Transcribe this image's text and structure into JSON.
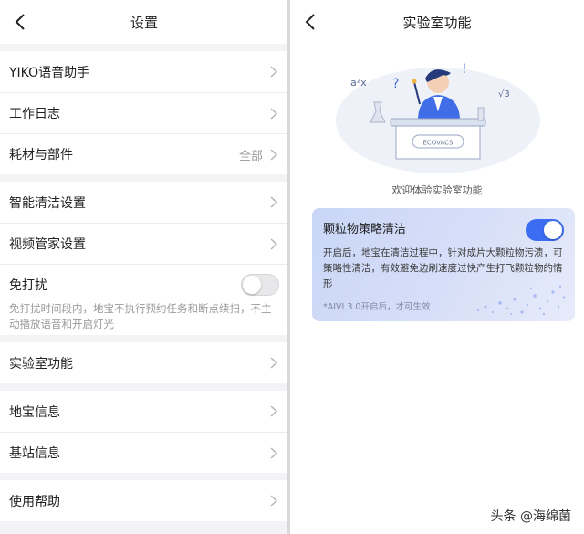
{
  "settings": {
    "title": "设置",
    "groups": [
      {
        "items": [
          {
            "label": "YIKO语音助手"
          },
          {
            "label": "工作日志"
          },
          {
            "label": "耗材与部件",
            "value": "全部"
          }
        ]
      },
      {
        "items": [
          {
            "label": "智能清洁设置"
          },
          {
            "label": "视频管家设置"
          }
        ]
      },
      {
        "items": [
          {
            "label": "实验室功能"
          }
        ]
      },
      {
        "items": [
          {
            "label": "地宝信息"
          },
          {
            "label": "基站信息"
          }
        ]
      },
      {
        "items": [
          {
            "label": "使用帮助"
          }
        ]
      }
    ],
    "dnd": {
      "label": "免打扰",
      "desc": "免打扰时间段内，地宝不执行预约任务和断点续扫，不主动播放语音和开启灯光",
      "enabled": false
    }
  },
  "lab": {
    "title": "实验室功能",
    "hero_brand": "ECOVACS",
    "hero_formula": "a²x",
    "hero_fraction": "√3",
    "welcome": "欢迎体验实验室功能",
    "feature": {
      "title": "颗粒物策略清洁",
      "desc": "开启后，地宝在清洁过程中，针对成片大颗粒物污渍，可策略性清洁，有效避免边刷速度过快产生打飞颗粒物的情形",
      "note": "*AIVI 3.0开启后，才可生效",
      "enabled": true
    }
  },
  "watermark": "头条 @海绵菌",
  "colors": {
    "accent": "#3b6cf1",
    "card_bg": "#d3dcf7",
    "page_bg": "#f3f3f5"
  }
}
